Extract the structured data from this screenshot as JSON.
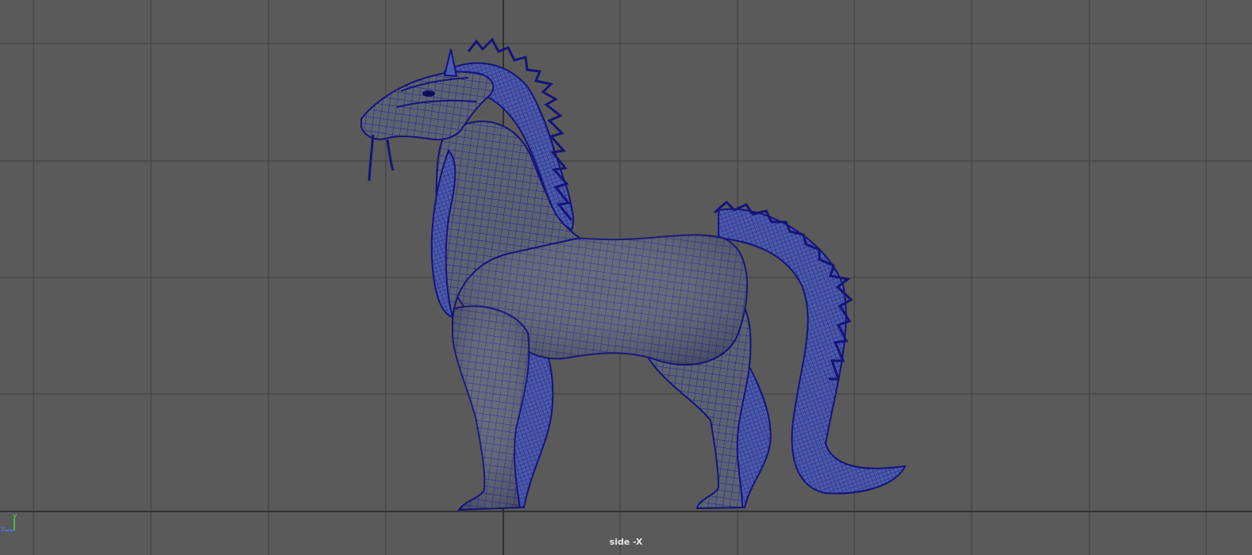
{
  "viewport": {
    "camera_label": "side -X",
    "background_color": "#5a5a5a",
    "grid_color": "#3d3d3d",
    "grid_axis_color": "#2a2a2a",
    "wire_color": "#1a1a8c",
    "mesh_fill": "#5b6170",
    "mane_color": "#4a5cae"
  },
  "axis_gizmo": {
    "y_label": "y",
    "z_label": "z",
    "y_color": "#44dd44",
    "z_color": "#4477ff"
  },
  "model": {
    "icon": "dragon-horse-mesh-icon",
    "selected": true
  }
}
